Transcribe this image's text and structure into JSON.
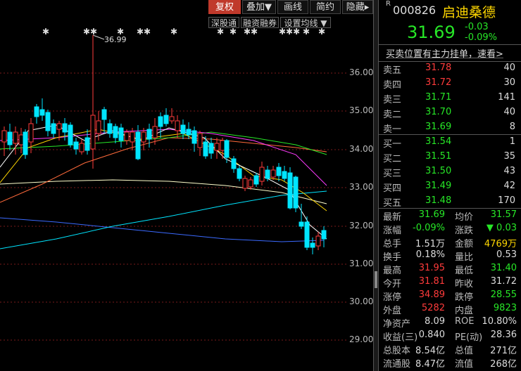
{
  "toolbar": {
    "buttons": [
      "复权",
      "叠加▼",
      "画线",
      "简约",
      "隐藏▸"
    ],
    "sub_buttons": [
      "深股通",
      "融资融券",
      "设置均线 ▼"
    ]
  },
  "chart": {
    "y_ticks": [
      "36.00",
      "35.00",
      "34.00",
      "33.00",
      "32.00",
      "31.00",
      "30.00",
      "29.00"
    ],
    "high_annotation": "36.99",
    "colors": {
      "up": "#ff3b3b",
      "down": "#00e5ff",
      "ma5": "#ffffff",
      "ma10": "#ffd700",
      "ma20": "#ff3bff",
      "ma30": "#27e727",
      "ma60": "#ff6a3b",
      "ma120": "#ffffcc",
      "ma250": "#3b6aff",
      "ma_cyan": "#00e5ff"
    }
  },
  "header": {
    "superscript": "R",
    "code": "000826",
    "name": "启迪桑德",
    "price": "31.69",
    "change": "-0.03",
    "change_pct": "-0.09%"
  },
  "banner": "买卖位置有主力挂单，速看>",
  "order_book": {
    "asks": [
      {
        "label": "卖五",
        "price": "31.78",
        "vol": "40"
      },
      {
        "label": "卖四",
        "price": "31.72",
        "vol": "30"
      },
      {
        "label": "卖三",
        "price": "31.71",
        "vol": "141"
      },
      {
        "label": "卖二",
        "price": "31.70",
        "vol": "40"
      },
      {
        "label": "卖一",
        "price": "31.69",
        "vol": "8"
      }
    ],
    "bids": [
      {
        "label": "买一",
        "price": "31.54",
        "vol": "1"
      },
      {
        "label": "买二",
        "price": "31.51",
        "vol": "35"
      },
      {
        "label": "买三",
        "price": "31.50",
        "vol": "43"
      },
      {
        "label": "买四",
        "price": "31.49",
        "vol": "42"
      },
      {
        "label": "买五",
        "price": "31.48",
        "vol": "170"
      }
    ]
  },
  "stats": [
    {
      "l1": "最新",
      "v1": "31.69",
      "c1": "green",
      "l2": "均价",
      "v2": "31.57",
      "c2": "green"
    },
    {
      "l1": "涨幅",
      "v1": "-0.09%",
      "c1": "green",
      "l2": "涨跌",
      "v2": "▼ 0.03",
      "c2": "green"
    },
    {
      "l1": "总手",
      "v1": "1.51万",
      "c1": "white",
      "l2": "金额",
      "v2": "4769万",
      "c2": "yellow"
    },
    {
      "l1": "换手",
      "v1": "0.18%",
      "c1": "white",
      "l2": "量比",
      "v2": "0.53",
      "c2": "white"
    },
    {
      "l1": "最高",
      "v1": "31.95",
      "c1": "red",
      "l2": "最低",
      "v2": "31.40",
      "c2": "green"
    },
    {
      "l1": "今开",
      "v1": "31.81",
      "c1": "red",
      "l2": "昨收",
      "v2": "31.72",
      "c2": "white"
    },
    {
      "l1": "涨停",
      "v1": "34.89",
      "c1": "red",
      "l2": "跌停",
      "v2": "28.55",
      "c2": "green"
    },
    {
      "l1": "外盘",
      "v1": "5282",
      "c1": "red",
      "l2": "内盘",
      "v2": "9823",
      "c2": "green"
    },
    {
      "l1": "净资产",
      "v1": "8.09",
      "c1": "white",
      "l2": "ROE",
      "v2": "10.80%",
      "c2": "white"
    },
    {
      "l1": "收益(三)",
      "v1": "0.840",
      "c1": "white",
      "l2": "PE(动)",
      "v2": "28.36",
      "c2": "white"
    },
    {
      "l1": "总股本",
      "v1": "8.54亿",
      "c1": "white",
      "l2": "总值",
      "v2": "271亿",
      "c2": "white"
    },
    {
      "l1": "流通股",
      "v1": "8.47亿",
      "c1": "white",
      "l2": "流值",
      "v2": "268亿",
      "c2": "white"
    }
  ]
}
